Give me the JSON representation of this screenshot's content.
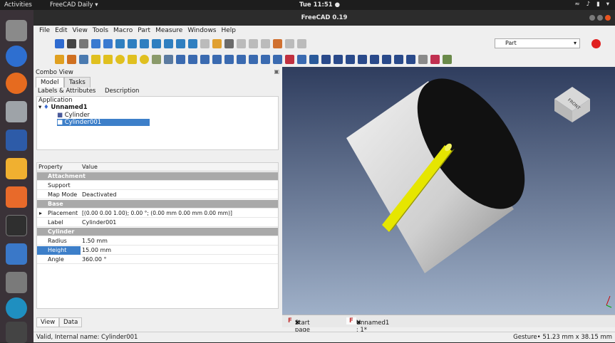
{
  "topbar": {
    "activities": "Activities",
    "app_name": "FreeCAD Daily ▾",
    "clock": "Tue 11:51 ●"
  },
  "window": {
    "title": "FreeCAD 0.19"
  },
  "menu": [
    "File",
    "Edit",
    "View",
    "Tools",
    "Macro",
    "Part",
    "Measure",
    "Windows",
    "Help"
  ],
  "toolbar": {
    "workbench": "Part"
  },
  "combo": {
    "title": "Combo View",
    "tabs": [
      "Model",
      "Tasks"
    ],
    "tree_headers": [
      "Labels & Attributes",
      "Description"
    ],
    "tree": {
      "root": "Application",
      "doc": "Unnamed1",
      "items": [
        "Cylinder",
        "Cylinder001"
      ]
    }
  },
  "props": {
    "headers": [
      "Property",
      "Value"
    ],
    "rows": [
      {
        "type": "group",
        "key": "Attachment"
      },
      {
        "key": "Support",
        "value": ""
      },
      {
        "key": "Map Mode",
        "value": "Deactivated"
      },
      {
        "type": "group",
        "key": "Base"
      },
      {
        "key": "Placement",
        "value": "[(0.00 0.00 1.00); 0.00 °; (0.00 mm  0.00 mm  0.00 mm)]"
      },
      {
        "key": "Label",
        "value": "Cylinder001"
      },
      {
        "type": "group",
        "key": "Cylinder"
      },
      {
        "key": "Radius",
        "value": "1.50 mm"
      },
      {
        "key": "Height",
        "value": "15.00 mm",
        "selected": true
      },
      {
        "key": "Angle",
        "value": "360.00 °"
      }
    ]
  },
  "bottom_tabs": [
    "View",
    "Data"
  ],
  "view_tabs": [
    "Start page",
    "Unnamed1 : 1*"
  ],
  "status": {
    "left": "Valid, Internal name: Cylinder001",
    "right": "Gesture•  51.23 mm x 38.15 mm"
  },
  "navcube": {
    "face": "FRONT"
  }
}
